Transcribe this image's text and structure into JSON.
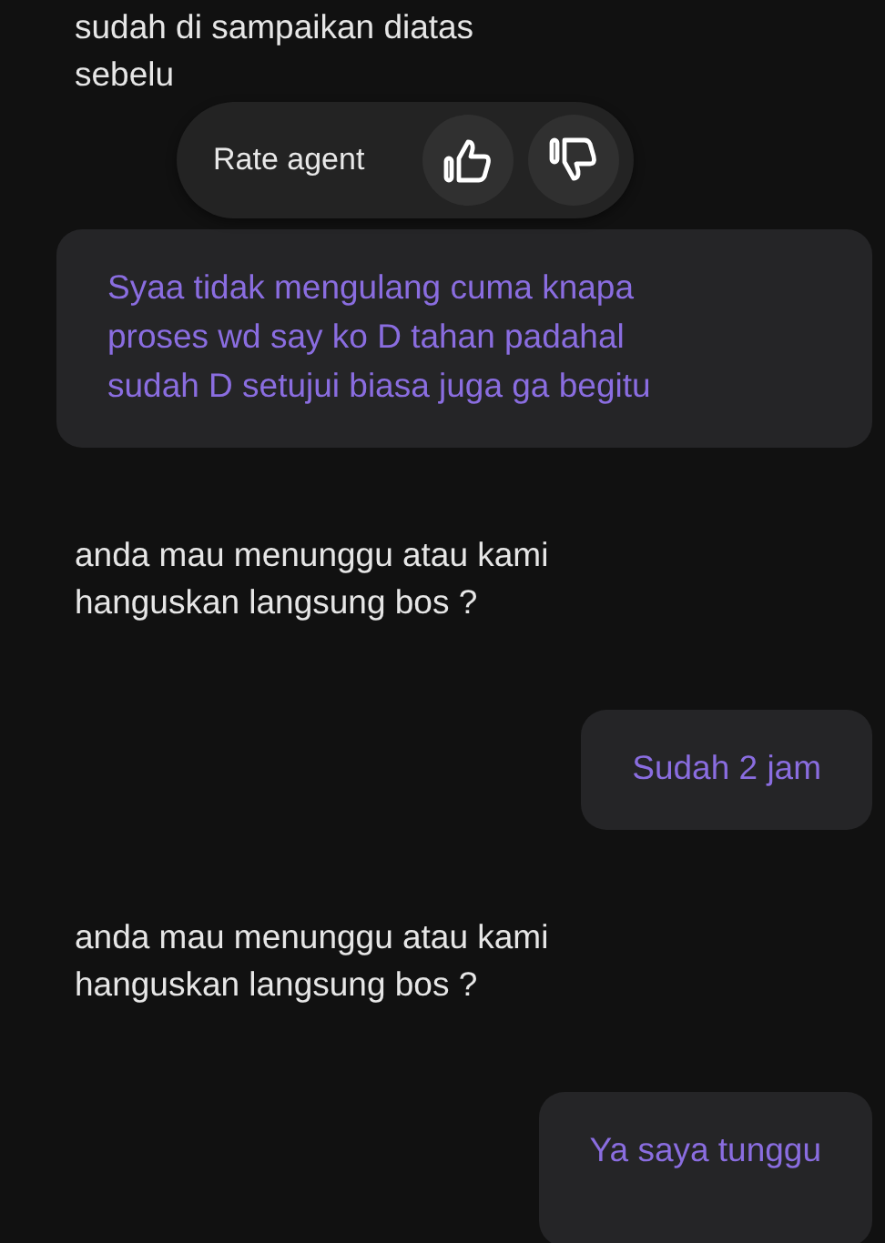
{
  "messages": [
    {
      "kind": "agent",
      "lines": [
        "sudah di sampaikan diatas",
        "sebelu"
      ]
    },
    {
      "kind": "user",
      "lines": [
        "Syaa tidak mengulang cuma knapa",
        "proses wd say ko D tahan padahal",
        "sudah D setujui biasa juga ga begitu"
      ]
    },
    {
      "kind": "agent",
      "lines": [
        "anda mau menunggu atau kami",
        "hanguskan langsung bos ?"
      ]
    },
    {
      "kind": "user",
      "lines": [
        "Sudah 2 jam"
      ]
    },
    {
      "kind": "agent",
      "lines": [
        "anda mau menunggu atau kami",
        "hanguskan langsung bos ?"
      ]
    },
    {
      "kind": "user",
      "lines": [
        "Ya saya tunggu"
      ]
    }
  ],
  "rating": {
    "label": "Rate agent"
  }
}
